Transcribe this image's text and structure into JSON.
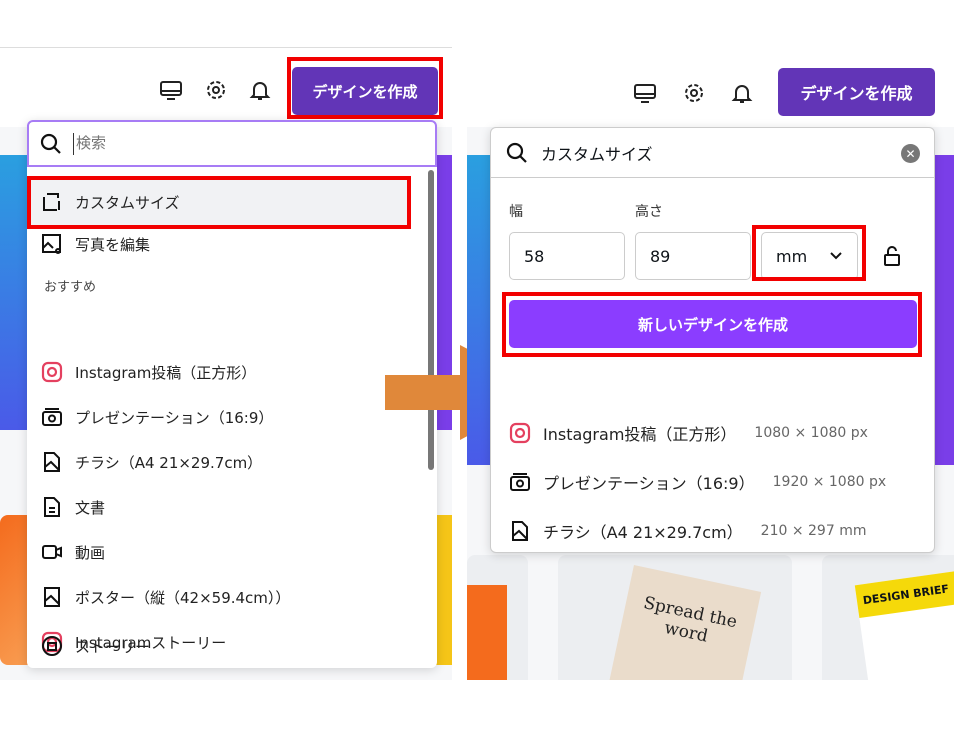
{
  "left": {
    "header": {
      "create_button": "デザインを作成"
    },
    "search": {
      "placeholder": "検索"
    },
    "items": [
      {
        "label": "カスタムサイズ",
        "icon": "custom-size-icon"
      },
      {
        "label": "写真を編集",
        "icon": "photo-edit-icon"
      }
    ],
    "section_title": "おすすめ",
    "recommended": [
      {
        "label": "Instagram投稿（正方形）",
        "icon": "instagram-icon"
      },
      {
        "label": "プレゼンテーション（16:9）",
        "icon": "presentation-icon"
      },
      {
        "label": "チラシ（A4 21×29.7cm）",
        "icon": "flyer-icon"
      },
      {
        "label": "文書",
        "icon": "document-icon"
      },
      {
        "label": "動画",
        "icon": "video-icon"
      },
      {
        "label": "ポスター（縦（42×59.4cm））",
        "icon": "poster-icon"
      },
      {
        "label": "Instagramストーリー",
        "icon": "instagram-icon"
      },
      {
        "label": "ストーリー",
        "icon": "story-icon"
      }
    ]
  },
  "right": {
    "header": {
      "create_button": "デザインを作成"
    },
    "search": {
      "value": "カスタムサイズ"
    },
    "width_label": "幅",
    "height_label": "高さ",
    "width_value": "58",
    "height_value": "89",
    "unit": "mm",
    "new_design_button": "新しいデザインを作成",
    "suggestions": [
      {
        "label": "Instagram投稿（正方形）",
        "size": "1080 × 1080 px",
        "icon": "instagram-icon"
      },
      {
        "label": "プレゼンテーション（16:9）",
        "size": "1920 × 1080 px",
        "icon": "presentation-icon"
      },
      {
        "label": "チラシ（A4 21×29.7cm）",
        "size": "210 × 297 mm",
        "icon": "flyer-icon"
      }
    ],
    "thumb_texts": {
      "flyer": "Spread the word",
      "brief": "DESIGN BRIEF"
    }
  },
  "colors": {
    "brand": "#6235b7",
    "button": "#8b3dff",
    "highlight": "#f20000",
    "arrow": "#e0883a"
  }
}
